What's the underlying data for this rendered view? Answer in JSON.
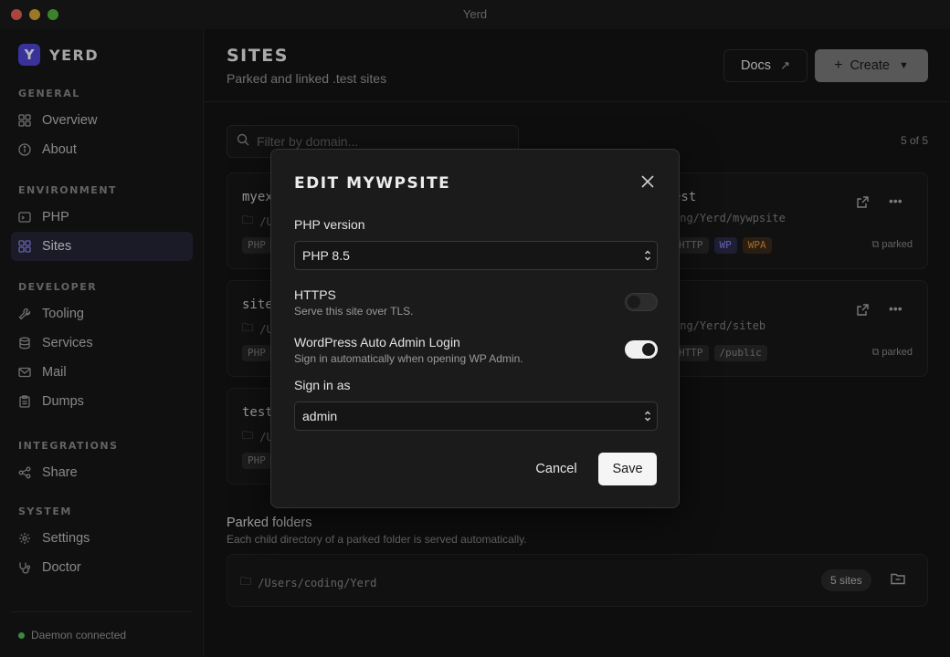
{
  "window": {
    "title": "Yerd"
  },
  "brand": {
    "logo_letter": "Y",
    "name": "Yerd",
    "accent": "#4f46d6"
  },
  "sidebar": {
    "groups": [
      {
        "title": "General",
        "items": [
          {
            "label": "Overview",
            "icon": "grid-icon"
          },
          {
            "label": "About",
            "icon": "info-icon"
          }
        ]
      },
      {
        "title": "Environment",
        "items": [
          {
            "label": "PHP",
            "icon": "code-icon"
          },
          {
            "label": "Sites",
            "icon": "grid-icon",
            "active": true
          }
        ]
      },
      {
        "title": "Developer",
        "items": [
          {
            "label": "Tooling",
            "icon": "wrench-icon"
          },
          {
            "label": "Services",
            "icon": "database-icon"
          },
          {
            "label": "Mail",
            "icon": "mail-icon"
          },
          {
            "label": "Dumps",
            "icon": "clipboard-icon"
          }
        ]
      },
      {
        "title": "Integrations",
        "items": [
          {
            "label": "Share",
            "icon": "share-icon"
          }
        ]
      },
      {
        "title": "System",
        "items": [
          {
            "label": "Settings",
            "icon": "gear-icon"
          },
          {
            "label": "Doctor",
            "icon": "stethoscope-icon"
          }
        ]
      }
    ],
    "status": {
      "label": "Daemon connected",
      "color": "#4ec05e"
    }
  },
  "header": {
    "title": "Sites",
    "subtitle": "Parked and linked .test sites",
    "docs_label": "Docs",
    "create_label": "Create"
  },
  "filter": {
    "placeholder": "Filter by domain...",
    "count": "5 of 5"
  },
  "cards": [
    {
      "name": "myex",
      "path": "/U",
      "tags": [
        "PHP"
      ]
    },
    {
      "name": "site",
      "path": "/U",
      "tags": [
        "PHP"
      ]
    },
    {
      "name": "test",
      "path": "/U",
      "tags": [
        "PHP"
      ]
    },
    {
      "name": "est",
      "path": "ing/Yerd/mywpsite",
      "tags": [
        "HTTP",
        "WP",
        "WPA"
      ],
      "status": "parked"
    },
    {
      "name": "",
      "path": "ing/Yerd/siteb",
      "tags": [
        "HTTP",
        "/public"
      ],
      "status": "parked"
    }
  ],
  "parked": {
    "title": "Parked folders",
    "description": "Each child directory of a parked folder is served automatically.",
    "folder_path": "/Users/coding/Yerd",
    "sites_badge": "5 sites"
  },
  "modal": {
    "title": "Edit mywpsite",
    "php_label": "PHP version",
    "php_value": "PHP 8.5",
    "https_title": "HTTPS",
    "https_desc": "Serve this site over TLS.",
    "https_on": false,
    "wp_title": "WordPress Auto Admin Login",
    "wp_desc": "Sign in automatically when opening WP Admin.",
    "wp_on": true,
    "signin_label": "Sign in as",
    "signin_value": "admin",
    "cancel_label": "Cancel",
    "save_label": "Save"
  }
}
